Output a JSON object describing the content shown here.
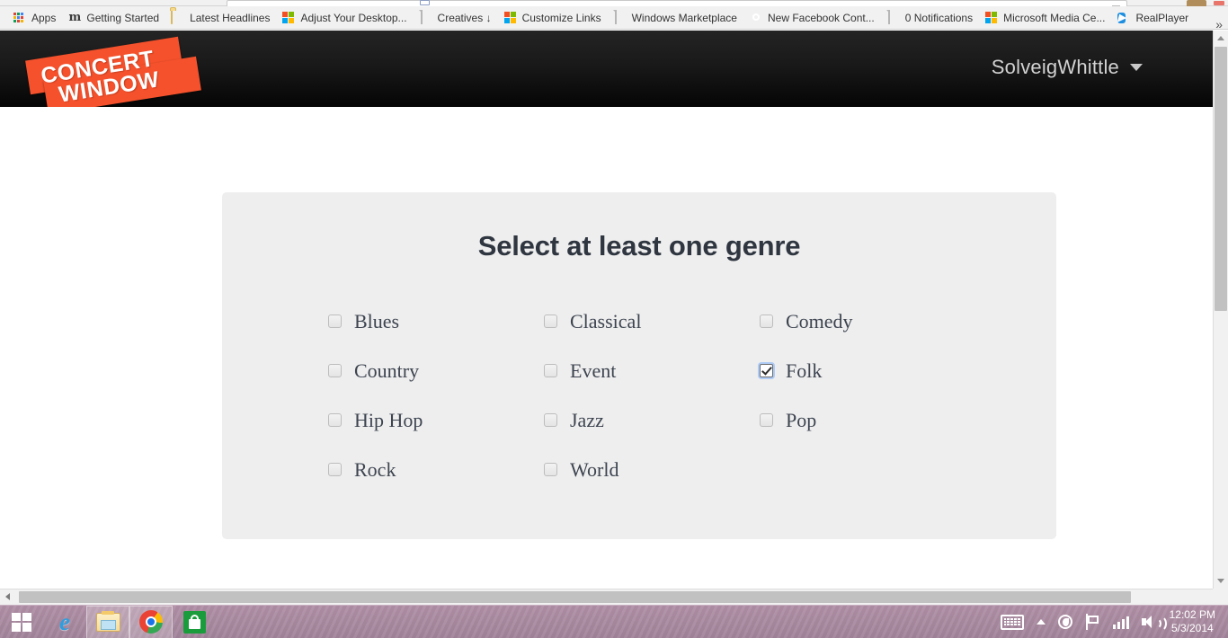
{
  "browser": {
    "bookmarks": [
      {
        "label": "Apps",
        "icon": "apps-grid-icon"
      },
      {
        "label": "Getting Started",
        "icon": "monogram-m-icon"
      },
      {
        "label": "Latest Headlines",
        "icon": "folder-icon"
      },
      {
        "label": "Adjust Your Desktop...",
        "icon": "microsoft-squares-icon"
      },
      {
        "label": "Creatives ↓",
        "icon": "document-icon"
      },
      {
        "label": "Customize Links",
        "icon": "microsoft-squares-icon"
      },
      {
        "label": "Windows Marketplace",
        "icon": "document-icon"
      },
      {
        "label": "New Facebook Cont...",
        "icon": "facebook-search-icon"
      },
      {
        "label": "0 Notifications",
        "icon": "document-icon"
      },
      {
        "label": "Microsoft Media Ce...",
        "icon": "microsoft-squares-icon"
      },
      {
        "label": "RealPlayer",
        "icon": "realplayer-icon"
      }
    ],
    "overflow_label": "»"
  },
  "site": {
    "logo": {
      "line1": "CONCERT",
      "line2": "WINDOW",
      "color": "#f4512c"
    },
    "user": {
      "name": "SolveigWhittle",
      "caret": "chevron-down-icon"
    }
  },
  "panel": {
    "title": "Select at least one genre",
    "background": "#eeeeee",
    "title_color": "#2f3640",
    "genres": [
      {
        "label": "Blues",
        "checked": false
      },
      {
        "label": "Classical",
        "checked": false
      },
      {
        "label": "Comedy",
        "checked": false
      },
      {
        "label": "Country",
        "checked": false
      },
      {
        "label": "Event",
        "checked": false
      },
      {
        "label": "Folk",
        "checked": true
      },
      {
        "label": "Hip Hop",
        "checked": false
      },
      {
        "label": "Jazz",
        "checked": false
      },
      {
        "label": "Pop",
        "checked": false
      },
      {
        "label": "Rock",
        "checked": false
      },
      {
        "label": "World",
        "checked": false
      }
    ]
  },
  "taskbar": {
    "buttons": [
      {
        "name": "start-button",
        "icon": "windows-start-icon",
        "active": false
      },
      {
        "name": "ie-button",
        "icon": "internet-explorer-icon",
        "active": false
      },
      {
        "name": "explorer-button",
        "icon": "file-explorer-icon",
        "active": true
      },
      {
        "name": "chrome-button",
        "icon": "chrome-icon",
        "active": true
      },
      {
        "name": "store-button",
        "icon": "windows-store-icon",
        "active": false
      }
    ],
    "tray": [
      {
        "name": "keyboard-tray-icon",
        "icon": "keyboard-icon"
      },
      {
        "name": "show-hidden-icons",
        "icon": "chevron-up-icon"
      },
      {
        "name": "dropbox-tray-icon",
        "icon": "dropbox-icon"
      },
      {
        "name": "action-center-icon",
        "icon": "flag-icon"
      },
      {
        "name": "network-tray-icon",
        "icon": "signal-bars-icon"
      },
      {
        "name": "volume-tray-icon",
        "icon": "speaker-icon"
      }
    ],
    "clock": {
      "time": "12:02 PM",
      "date": "5/3/2014"
    }
  }
}
